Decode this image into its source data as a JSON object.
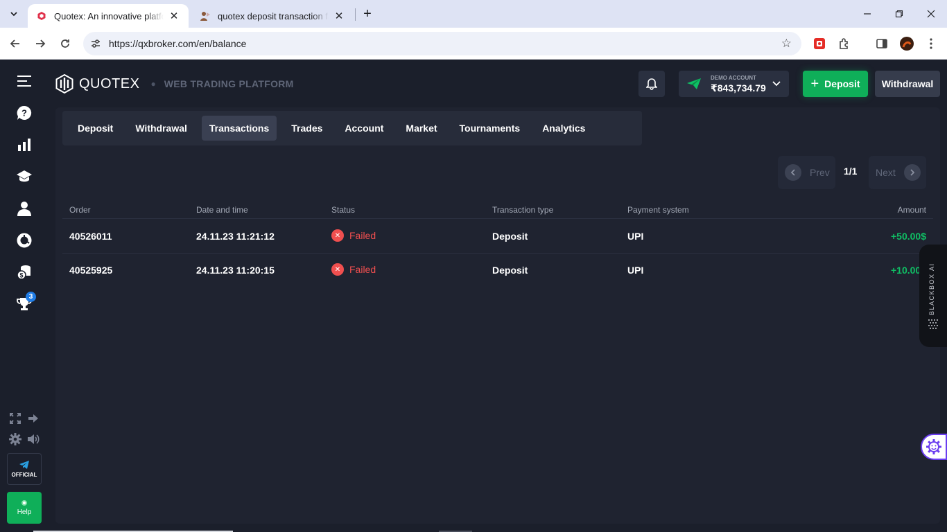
{
  "browser": {
    "tabs": [
      {
        "title": "Quotex: An innovative platform for online investment",
        "active": true
      },
      {
        "title": "quotex deposit transaction failed",
        "active": false
      }
    ],
    "url": "https://qxbroker.com/en/balance"
  },
  "header": {
    "brand": "QUOTEX",
    "subtitle": "WEB TRADING PLATFORM",
    "account_label": "DEMO ACCOUNT",
    "balance": "₹843,734.79",
    "deposit_label": "Deposit",
    "withdrawal_label": "Withdrawal"
  },
  "sidebar": {
    "badge_count": "3",
    "official_label": "OFFICIAL",
    "help_label": "Help"
  },
  "subnav": {
    "tabs": [
      "Deposit",
      "Withdrawal",
      "Transactions",
      "Trades",
      "Account",
      "Market",
      "Tournaments",
      "Analytics"
    ],
    "active": "Transactions"
  },
  "pagination": {
    "prev_label": "Prev",
    "next_label": "Next",
    "count": "1/1"
  },
  "table": {
    "columns": [
      "Order",
      "Date and time",
      "Status",
      "Transaction type",
      "Payment system",
      "Amount"
    ],
    "rows": [
      {
        "order": "40526011",
        "datetime": "24.11.23 11:21:12",
        "status": "Failed",
        "type": "Deposit",
        "payment": "UPI",
        "amount": "+50.00$"
      },
      {
        "order": "40525925",
        "datetime": "24.11.23 11:20:15",
        "status": "Failed",
        "type": "Deposit",
        "payment": "UPI",
        "amount": "+10.00$"
      }
    ]
  },
  "overlay": {
    "blackbox_label": "BLACKBOX AI"
  },
  "colors": {
    "accent_green": "#0faf59",
    "failed_red": "#f04f4f",
    "background": "#1b1f2b",
    "panel": "#1f2330"
  }
}
